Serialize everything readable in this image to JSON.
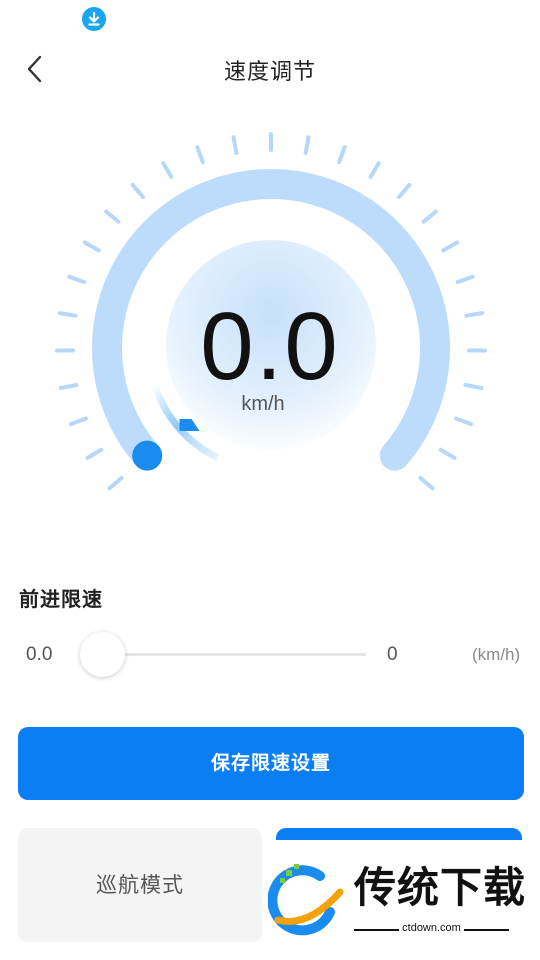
{
  "status_bar": {
    "download_icon": "download-icon"
  },
  "header": {
    "title": "速度调节",
    "back_icon": "chevron-left-icon"
  },
  "gauge": {
    "speed_value": "0.0",
    "unit": "km/h",
    "level_fraction": 0.0,
    "colors": {
      "ring": "#bddcfb",
      "ticks": "#b6d7f8",
      "accent": "#1a8cf0"
    }
  },
  "limit": {
    "title": "前进限速",
    "min_label": "0.0",
    "max_label": "0",
    "unit_label": "(km/h)",
    "value_fraction": 0.0
  },
  "actions": {
    "save_label": "保存限速设置",
    "cruise_label": "巡航模式"
  },
  "watermark": {
    "text": "传统下载",
    "sub": "ctdown.com"
  },
  "colors": {
    "primary": "#0a7ff5",
    "secondary_bg": "#f4f4f4"
  }
}
